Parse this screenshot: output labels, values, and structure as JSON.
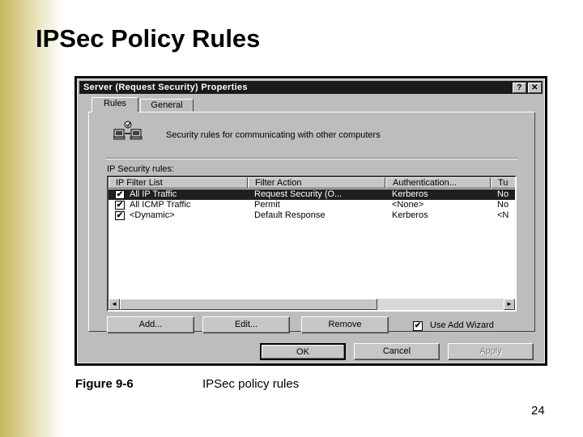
{
  "slide": {
    "title": "IPSec Policy Rules",
    "page_number": "24"
  },
  "dialog": {
    "title": "Server (Request Security) Properties",
    "title_buttons": {
      "help": "?",
      "close": "✕"
    },
    "tabs": [
      {
        "label": "Rules",
        "active": true
      },
      {
        "label": "General",
        "active": false
      }
    ],
    "description": "Security rules for communicating with other computers",
    "list_label": "IP Security rules:",
    "columns": [
      "IP Filter List",
      "Filter Action",
      "Authentication...",
      "Tu"
    ],
    "rows": [
      {
        "checked": true,
        "filter_list": "All IP Traffic",
        "filter_action": "Request Security (O...",
        "authentication": "Kerberos",
        "tunnel": "No",
        "selected": true
      },
      {
        "checked": true,
        "filter_list": "All ICMP Traffic",
        "filter_action": "Permit",
        "authentication": "<None>",
        "tunnel": "No",
        "selected": false
      },
      {
        "checked": true,
        "filter_list": "<Dynamic>",
        "filter_action": "Default Response",
        "authentication": "Kerberos",
        "tunnel": "<N",
        "selected": false
      }
    ],
    "scroll": {
      "left": "◄",
      "right": "►"
    },
    "buttons": {
      "add": "Add...",
      "edit": "Edit...",
      "remove": "Remove",
      "ok": "OK",
      "cancel": "Cancel",
      "apply": "Apply"
    },
    "use_wizard": {
      "label": "Use Add Wizard",
      "checked": true,
      "mark": "✔"
    }
  },
  "caption": {
    "figure": "Figure 9-6",
    "text": "IPSec policy rules"
  },
  "icons": {
    "rules": "network-computers-icon",
    "checkbox": "checkmark-icon"
  }
}
